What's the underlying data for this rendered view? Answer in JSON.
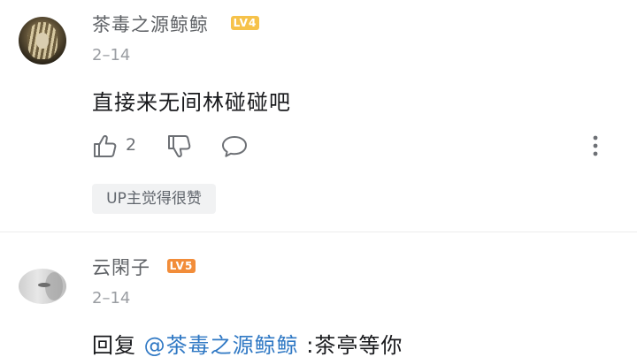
{
  "comments": [
    {
      "username": "茶毒之源鲸鲸",
      "level": "LV4",
      "date": "2–14",
      "content": "直接来无间林碰碰吧",
      "like_count": "2",
      "badge": "UP主觉得很赞"
    },
    {
      "username": "云閑子",
      "level": "LV5",
      "date": "2–14",
      "reply_prefix": "回复",
      "mention": "@茶毒之源鲸鲸",
      "reply_text": ":茶亭等你"
    }
  ],
  "colors": {
    "level4": "#f6c24a",
    "level5": "#f28d3a",
    "mention": "#2f78c4"
  },
  "icons": [
    "thumbs-up-icon",
    "thumbs-down-icon",
    "reply-bubble-icon",
    "more-vertical-icon"
  ]
}
